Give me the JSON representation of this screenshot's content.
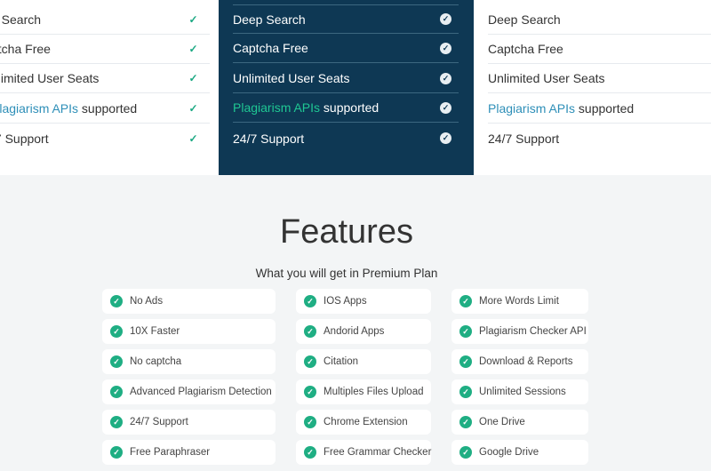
{
  "plans": {
    "left": {
      "items": [
        {
          "text": "p Search"
        },
        {
          "text": "ptcha Free"
        },
        {
          "text": "nlimited User Seats"
        },
        {
          "highlight": "Plagiarism APIs",
          "text": " supported"
        },
        {
          "text": "/7 Support"
        }
      ]
    },
    "middle": {
      "items": [
        {
          "text": "Deep Search"
        },
        {
          "text": "Captcha Free"
        },
        {
          "text": "Unlimited User Seats"
        },
        {
          "highlight": "Plagiarism APIs",
          "text": " supported"
        },
        {
          "text": "24/7 Support"
        }
      ]
    },
    "right": {
      "items": [
        {
          "text": "Deep Search"
        },
        {
          "text": "Captcha Free"
        },
        {
          "text": "Unlimited User Seats"
        },
        {
          "highlight": "Plagiarism APIs",
          "text": " supported"
        },
        {
          "text": "24/7 Support"
        }
      ]
    },
    "check_glyph": "✓"
  },
  "features": {
    "title": "Features",
    "subtitle": "What you will get in Premium Plan",
    "check_glyph": "✓",
    "columns": [
      [
        "No Ads",
        "10X Faster",
        "No captcha",
        "Advanced Plagiarism Detection",
        "24/7 Support",
        "Free Paraphraser"
      ],
      [
        "IOS Apps",
        "Andorid Apps",
        "Citation",
        "Multiples Files Upload",
        "Chrome Extension",
        "Free Grammar Checker"
      ],
      [
        "More Words Limit",
        "Plagiarism Checker API",
        "Download & Reports",
        "Unlimited Sessions",
        "One Drive",
        "Google Drive"
      ]
    ]
  },
  "colors": {
    "accent_green": "#1fae83",
    "navy": "#0e3854",
    "link_blue": "#2e8fb8"
  }
}
